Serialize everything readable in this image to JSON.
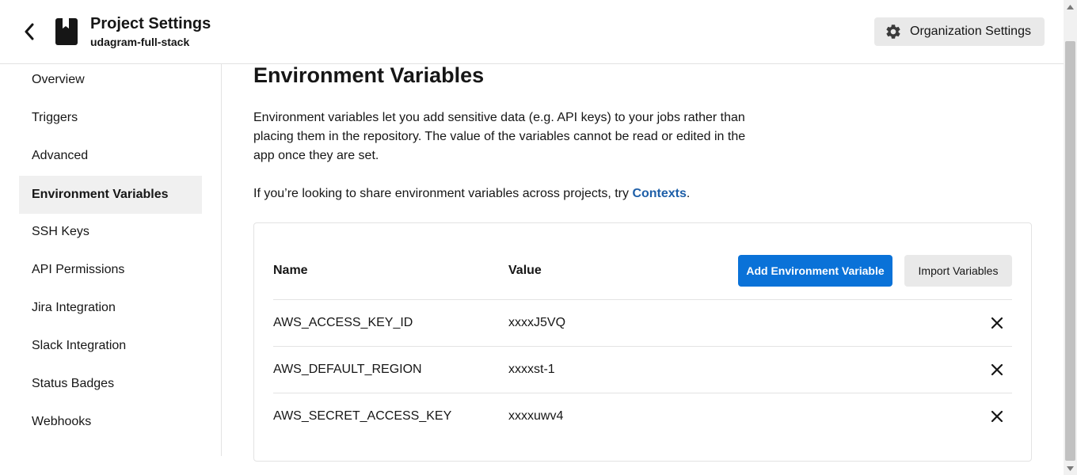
{
  "header": {
    "title": "Project Settings",
    "subtitle": "udagram-full-stack",
    "org_button_label": "Organization Settings"
  },
  "sidebar": {
    "items": [
      {
        "label": "Overview"
      },
      {
        "label": "Triggers"
      },
      {
        "label": "Advanced"
      },
      {
        "label": "Environment Variables",
        "active": true
      },
      {
        "label": "SSH Keys"
      },
      {
        "label": "API Permissions"
      },
      {
        "label": "Jira Integration"
      },
      {
        "label": "Slack Integration"
      },
      {
        "label": "Status Badges"
      },
      {
        "label": "Webhooks"
      }
    ]
  },
  "main": {
    "title": "Environment Variables",
    "description": "Environment variables let you add sensitive data (e.g. API keys) to your jobs rather than placing them in the repository. The value of the variables cannot be read or edited in the app once they are set.",
    "share_text": "If you’re looking to share environment variables across projects, try ",
    "share_link": "Contexts",
    "share_suffix": "."
  },
  "table": {
    "col_name": "Name",
    "col_value": "Value",
    "add_button": "Add Environment Variable",
    "import_button": "Import Variables",
    "rows": [
      {
        "name": "AWS_ACCESS_KEY_ID",
        "value": "xxxxJ5VQ"
      },
      {
        "name": "AWS_DEFAULT_REGION",
        "value": "xxxxst-1"
      },
      {
        "name": "AWS_SECRET_ACCESS_KEY",
        "value": "xxxxuwv4"
      }
    ]
  },
  "colors": {
    "primary": "#0a72d8",
    "link": "#1e5fa8",
    "active_bg": "#f0f0f0",
    "secondary_btn": "#e9e9e9"
  },
  "icons": {
    "back": "chevron-left-icon",
    "project": "book-icon",
    "settings": "gear-icon",
    "delete": "close-icon"
  }
}
